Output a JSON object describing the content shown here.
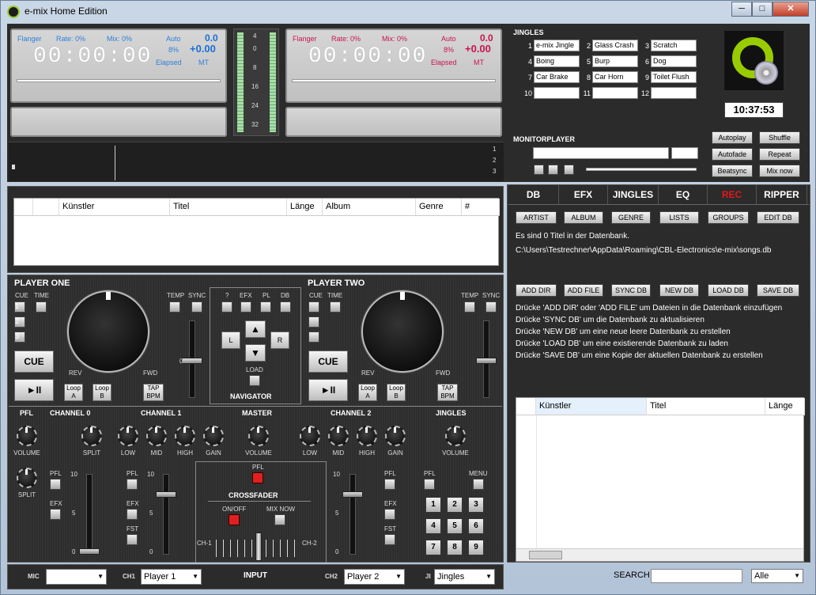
{
  "window": {
    "title": "e-mix Home Edition",
    "min": "─",
    "max": "□",
    "close": "✕"
  },
  "deck1": {
    "flanger": "Flanger",
    "rate": "Rate: 0%",
    "mix": "Mix: 0%",
    "auto": "Auto",
    "val1": "0.0",
    "time": "00:00:00",
    "pct": "8%",
    "pitch": "+0.00",
    "elapsed": "Elapsed",
    "mt": "MT"
  },
  "deck2": {
    "flanger": "Flanger",
    "rate": "Rate: 0%",
    "mix": "Mix: 0%",
    "auto": "Auto",
    "val1": "0.0",
    "time": "00:00:00",
    "pct": "8%",
    "pitch": "+0.00",
    "elapsed": "Elapsed",
    "mt": "MT"
  },
  "vu": [
    "4",
    "0",
    "8",
    "16",
    "24",
    "32"
  ],
  "wave_nums": [
    "1",
    "2",
    "3"
  ],
  "jingles": {
    "title": "JINGLES",
    "items": [
      {
        "n": "1",
        "t": "e-mix Jingle"
      },
      {
        "n": "2",
        "t": "Glass Crash"
      },
      {
        "n": "3",
        "t": "Scratch"
      },
      {
        "n": "4",
        "t": "Boing"
      },
      {
        "n": "5",
        "t": "Burp"
      },
      {
        "n": "6",
        "t": "Dog"
      },
      {
        "n": "7",
        "t": "Car Brake"
      },
      {
        "n": "8",
        "t": "Car Horn"
      },
      {
        "n": "9",
        "t": "Toilet Flush"
      },
      {
        "n": "10",
        "t": ""
      },
      {
        "n": "11",
        "t": ""
      },
      {
        "n": "12",
        "t": ""
      }
    ]
  },
  "clock": "10:37:53",
  "monitor": {
    "title": "MONITORPLAYER"
  },
  "auto_buttons": [
    "Autoplay",
    "Shuffle",
    "Autofade",
    "Repeat",
    "Beatsync",
    "Mix now"
  ],
  "playlist": {
    "cols": [
      "Künstler",
      "Titel",
      "Länge",
      "Album",
      "Genre",
      "#"
    ]
  },
  "player_one": {
    "title": "PLAYER ONE",
    "cue": "CUE",
    "time": "TIME",
    "temp": "TEMP",
    "sync": "SYNC",
    "cue_btn": "CUE",
    "play": "►II",
    "rev": "REV",
    "fwd": "FWD",
    "loopa": "Loop A",
    "loopb": "Loop B",
    "tap": "TAP BPM",
    "n1": "1",
    "n2": "2",
    "n3": "3"
  },
  "player_two": {
    "title": "PLAYER TWO",
    "cue": "CUE",
    "time": "TIME",
    "temp": "TEMP",
    "sync": "SYNC",
    "cue_btn": "CUE",
    "play": "►II",
    "rev": "REV",
    "fwd": "FWD",
    "loopa": "Loop A",
    "loopb": "Loop B",
    "tap": "TAP BPM",
    "n1": "1",
    "n2": "2",
    "n3": "3"
  },
  "navigator": {
    "title": "NAVIGATOR",
    "q": "?",
    "efx": "EFX",
    "pl": "PL",
    "db": "DB",
    "l": "L",
    "r": "R",
    "up": "▲",
    "down": "▼",
    "load": "LOAD"
  },
  "mixer": {
    "pfl": "PFL",
    "ch0": "CHANNEL 0",
    "ch1": "CHANNEL 1",
    "master": "MASTER",
    "ch2": "CHANNEL 2",
    "jingles": "JINGLES",
    "volume": "VOLUME",
    "split": "SPLIT",
    "low": "LOW",
    "mid": "MID",
    "high": "HIGH",
    "gain": "GAIN",
    "efx": "EFX",
    "fst": "FST",
    "menu": "MENU",
    "crossfader": "CROSSFADER",
    "onoff": "ON/OFF",
    "mixnow": "MIX NOW",
    "chl": "CH-1",
    "chr": "CH-2",
    "s10": "10",
    "s5": "5",
    "s0": "0",
    "pad": [
      "1",
      "2",
      "3",
      "4",
      "5",
      "6",
      "7",
      "8",
      "9"
    ]
  },
  "input": {
    "mic": "MIC",
    "ch1": "CH1",
    "ch1_val": "Player 1",
    "title": "INPUT",
    "ch2": "CH2",
    "ch2_val": "Player 2",
    "ji": "JI",
    "ji_val": "Jingles"
  },
  "tabs": [
    "DB",
    "EFX",
    "JINGLES",
    "EQ",
    "REC",
    "RIPPER"
  ],
  "db_buttons": [
    "ARTIST",
    "ALBUM",
    "GENRE",
    "LISTS",
    "GROUPS",
    "EDIT DB"
  ],
  "db_info": "Es sind 0 Titel in der Datenbank.",
  "db_path": "C:\\Users\\Testrechner\\AppData\\Roaming\\CBL-Electronics\\e-mix\\songs.db",
  "db_actions": [
    "ADD DIR",
    "ADD FILE",
    "SYNC DB",
    "NEW DB",
    "LOAD DB",
    "SAVE DB"
  ],
  "db_help": [
    "Drücke 'ADD DIR' oder 'ADD FILE' um Dateien in die Datenbank einzufügen",
    "Drücke 'SYNC DB' um die Datenbank zu aktualisieren",
    "Drücke 'NEW DB' um eine neue leere Datenbank zu erstellen",
    "Drücke 'LOAD DB' um eine existierende Datenbank zu laden",
    "Drücke 'SAVE DB' um eine Kopie der aktuellen Datenbank zu erstellen"
  ],
  "db_table": {
    "cols": [
      "Künstler",
      "Titel",
      "Länge"
    ]
  },
  "search": {
    "label": "SEARCH",
    "filter": "Alle"
  }
}
